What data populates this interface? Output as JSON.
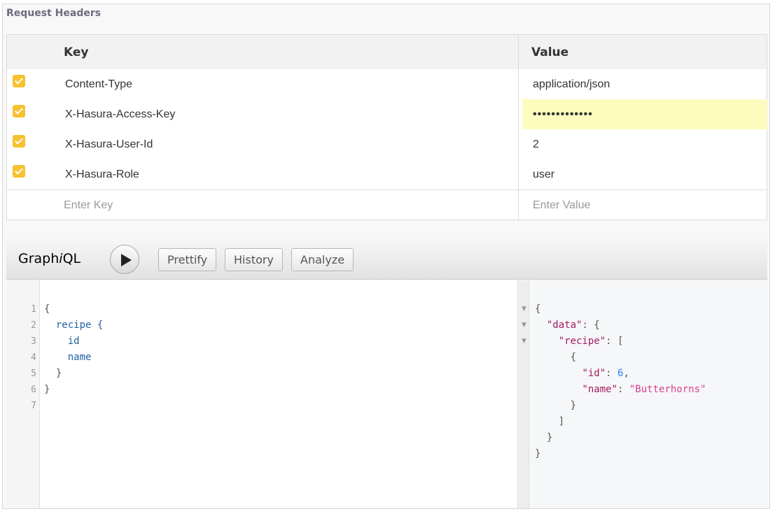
{
  "headers_section": {
    "title": "Request Headers",
    "columns": {
      "key": "Key",
      "value": "Value"
    },
    "rows": [
      {
        "key": "Content-Type",
        "value": "application/json",
        "checked": true
      },
      {
        "key": "X-Hasura-Access-Key",
        "value": "•••••••••••••",
        "checked": true
      },
      {
        "key": "X-Hasura-User-Id",
        "value": "2",
        "checked": true
      },
      {
        "key": "X-Hasura-Role",
        "value": "user",
        "checked": true
      }
    ],
    "new_row": {
      "key_placeholder": "Enter Key",
      "value_placeholder": "Enter Value"
    }
  },
  "graphiql": {
    "logo_prefix": "Graph",
    "logo_italic": "i",
    "logo_suffix": "QL",
    "buttons": {
      "prettify": "Prettify",
      "history": "History",
      "analyze": "Analyze"
    },
    "run_icon": "play-icon",
    "query": {
      "line_numbers": [
        "1",
        "2",
        "3",
        "4",
        "5",
        "6",
        "7"
      ],
      "lines": [
        "{",
        "  recipe {",
        "    id",
        "    name",
        "  }",
        "}",
        ""
      ]
    },
    "result": {
      "lines": [
        "{",
        "  \"data\": {",
        "    \"recipe\": [",
        "      {",
        "        \"id\": 6,",
        "        \"name\": \"Butterhorns\"",
        "      }",
        "    ]",
        "  }",
        "}"
      ],
      "data_key": "\"data\"",
      "recipe_key": "\"recipe\"",
      "id_key": "\"id\"",
      "id_value": "6",
      "name_key": "\"name\"",
      "name_value": "\"Butterhorns\""
    }
  },
  "colors": {
    "checkbox": "#f7c231",
    "password_highlight": "#fcfcbe",
    "json_key": "#a21a64",
    "json_string": "#d64292",
    "json_number": "#2882f9",
    "query_field": "#1f61a0"
  }
}
